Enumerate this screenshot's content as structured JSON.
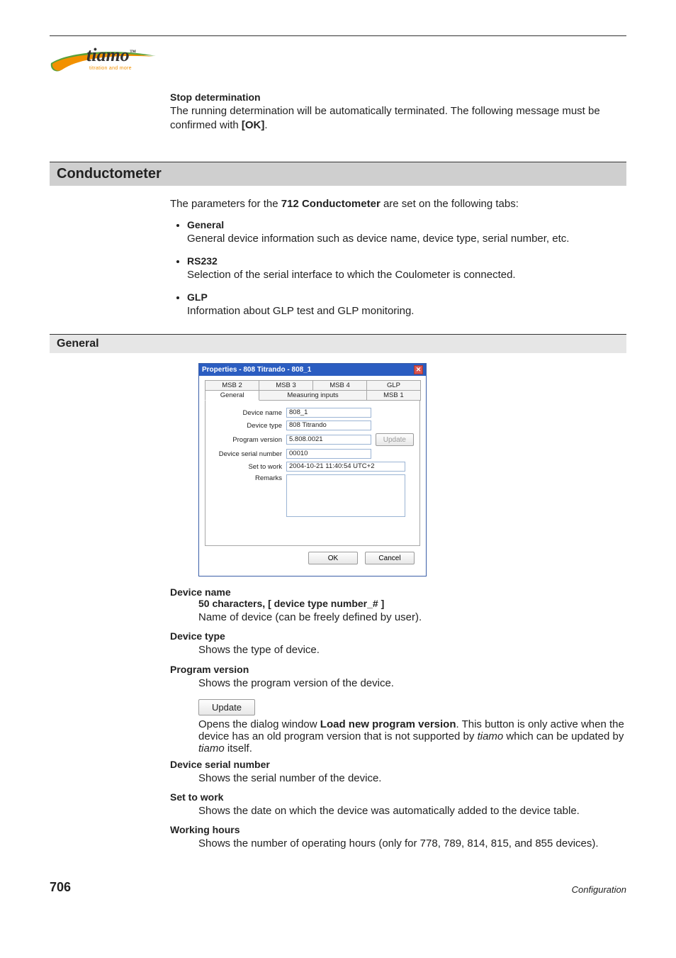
{
  "logo": {
    "name": "tiamo",
    "tm": "™",
    "tagline": "titration and more"
  },
  "stop": {
    "label": "Stop determination",
    "text_a": "The running determination will be automatically terminated. The following message must be confirmed with ",
    "ok": "[OK]",
    "text_b": "."
  },
  "cond": {
    "title": "Conductometer",
    "intro_a": "The parameters for the ",
    "intro_b": "712 Conductometer",
    "intro_c": " are set on the following tabs:",
    "bullets": [
      {
        "head": "General",
        "body": "General device information such as device name, device type, serial number, etc."
      },
      {
        "head": "RS232",
        "body": "Selection of the serial interface to which the Coulometer is connected."
      },
      {
        "head": "GLP",
        "body": "Information about GLP test and GLP monitoring."
      }
    ]
  },
  "general_section": {
    "title": "General"
  },
  "dialog": {
    "title": "Properties - 808 Titrando - 808_1",
    "tabs_row1": [
      "MSB 2",
      "MSB 3",
      "MSB 4",
      "GLP"
    ],
    "tabs_row2": [
      "General",
      "Measuring inputs",
      "MSB 1"
    ],
    "fields": {
      "device_name": {
        "label": "Device name",
        "value": "808_1"
      },
      "device_type": {
        "label": "Device type",
        "value": "808 Titrando"
      },
      "program_version": {
        "label": "Program version",
        "value": "5.808.0021"
      },
      "serial": {
        "label": "Device serial number",
        "value": "00010"
      },
      "set_to_work": {
        "label": "Set to work",
        "value": "2004-10-21 11:40:54 UTC+2"
      },
      "remarks": {
        "label": "Remarks",
        "value": ""
      }
    },
    "update_btn": "Update",
    "ok": "OK",
    "cancel": "Cancel"
  },
  "defs": {
    "device_name": {
      "head": "Device name",
      "prop": "50 characters, [ device type number_# ]",
      "text": "Name of device (can be freely defined by user)."
    },
    "device_type": {
      "head": "Device type",
      "text": "Shows the type of device."
    },
    "program_version": {
      "head": "Program version",
      "text": "Shows the program version of the device."
    },
    "update": {
      "btn": "Update",
      "text_a": "Opens the dialog window ",
      "text_b": "Load new program version",
      "text_c": ". This button is only active when the device has an old program version that is not supported by ",
      "text_d": "tiamo",
      "text_e": " which can be updated by ",
      "text_f": "tiamo",
      "text_g": " itself."
    },
    "serial": {
      "head": "Device serial number",
      "text": "Shows the serial number of the device."
    },
    "set_to_work": {
      "head": "Set to work",
      "text": "Shows the date on which the device was automatically added to the device table."
    },
    "working_hours": {
      "head": "Working hours",
      "text": "Shows the number of operating hours (only for 778, 789, 814, 815, and 855 devices)."
    }
  },
  "footer": {
    "page": "706",
    "section": "Configuration"
  }
}
